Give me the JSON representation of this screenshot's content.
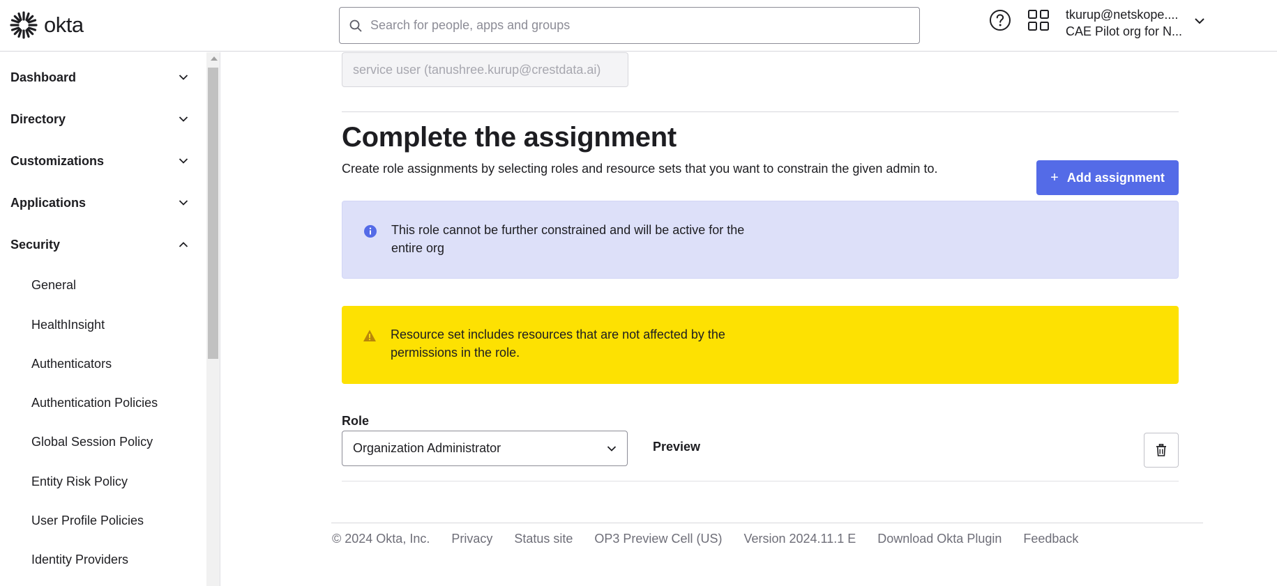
{
  "header": {
    "logo_text": "okta",
    "search_placeholder": "Search for people, apps and groups",
    "user_email": "tkurup@netskope....",
    "user_org": "CAE Pilot org for N..."
  },
  "sidebar": {
    "sections": [
      {
        "label": "Dashboard",
        "expanded": false
      },
      {
        "label": "Directory",
        "expanded": false
      },
      {
        "label": "Customizations",
        "expanded": false
      },
      {
        "label": "Applications",
        "expanded": false
      },
      {
        "label": "Security",
        "expanded": true
      }
    ],
    "security_items": [
      "General",
      "HealthInsight",
      "Authenticators",
      "Authentication Policies",
      "Global Session Policy",
      "Entity Risk Policy",
      "User Profile Policies",
      "Identity Providers"
    ]
  },
  "main": {
    "admin_field_value": "service user (tanushree.kurup@crestdata.ai)",
    "title": "Complete the assignment",
    "description": "Create role assignments by selecting roles and resource sets that you want to constrain the given admin to.",
    "add_button_label": "Add assignment",
    "info_message": "This role cannot be further constrained and will be active for the entire org",
    "warning_message": "Resource set includes resources that are not affected by the permissions in the role.",
    "role_label": "Role",
    "role_value": "Organization Administrator",
    "preview_label": "Preview"
  },
  "footer": {
    "copyright": "© 2024 Okta, Inc.",
    "privacy": "Privacy",
    "status": "Status site",
    "cell": "OP3 Preview Cell (US)",
    "version": "Version 2024.11.1 E",
    "plugin": "Download Okta Plugin",
    "feedback": "Feedback"
  },
  "colors": {
    "primary": "#546be7",
    "info_bg": "#dde0f9",
    "warning_bg": "#fde102",
    "warning_icon": "#b8860b"
  }
}
